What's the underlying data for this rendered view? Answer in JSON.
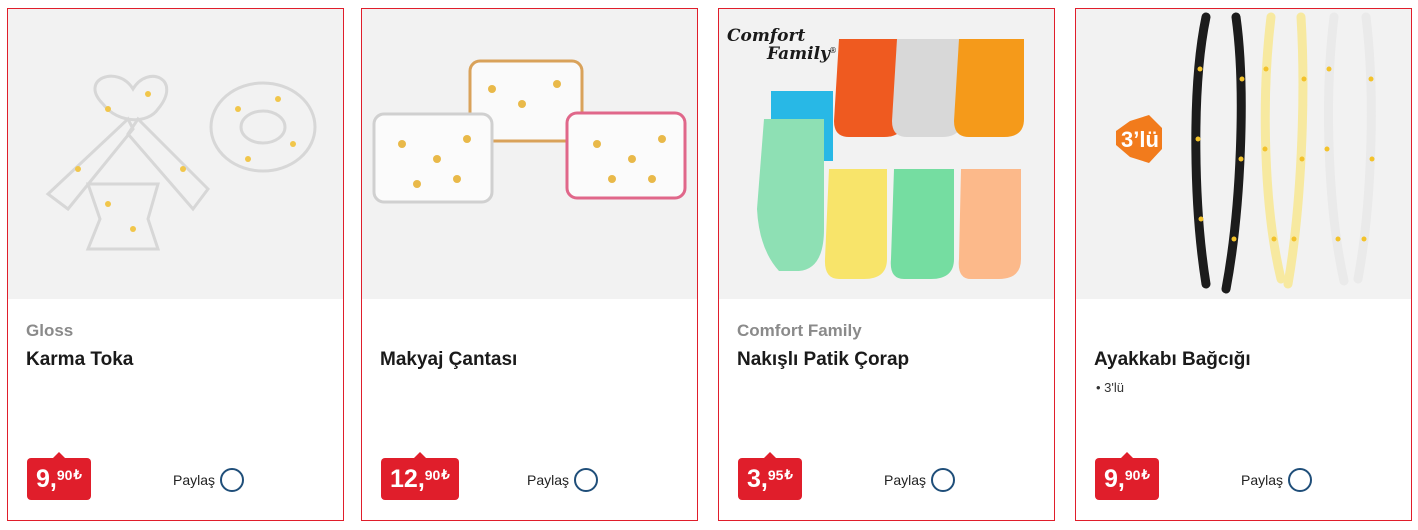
{
  "products": [
    {
      "brand": "Gloss",
      "title": "Karma Toka",
      "feature": "",
      "price": {
        "int": "9",
        "sep": ",",
        "dec": "90",
        "currency": "₺"
      },
      "share_label": "Paylaş"
    },
    {
      "brand": "",
      "title": "Makyaj Çantası",
      "feature": "",
      "price": {
        "int": "12",
        "sep": ",",
        "dec": "90",
        "currency": "₺"
      },
      "share_label": "Paylaş"
    },
    {
      "brand": "Comfort Family",
      "title": "Nakışlı Patik Çorap",
      "feature": "",
      "price": {
        "int": "3",
        "sep": ",",
        "dec": "95",
        "currency": "₺"
      },
      "share_label": "Paylaş",
      "image_logo": {
        "line1": "Comfort",
        "line2": "Family",
        "mark": "®"
      }
    },
    {
      "brand": "",
      "title": "Ayakkabı Bağcığı",
      "feature": "• 3'lü",
      "price": {
        "int": "9",
        "sep": ",",
        "dec": "90",
        "currency": "₺"
      },
      "share_label": "Paylaş",
      "image_badge": "3’lü"
    }
  ],
  "colors": {
    "accent_red": "#e01e2b",
    "share_blue": "#1f4e79",
    "image_bg": "#f2f2f2"
  },
  "icons": {
    "share": "share-icon"
  }
}
